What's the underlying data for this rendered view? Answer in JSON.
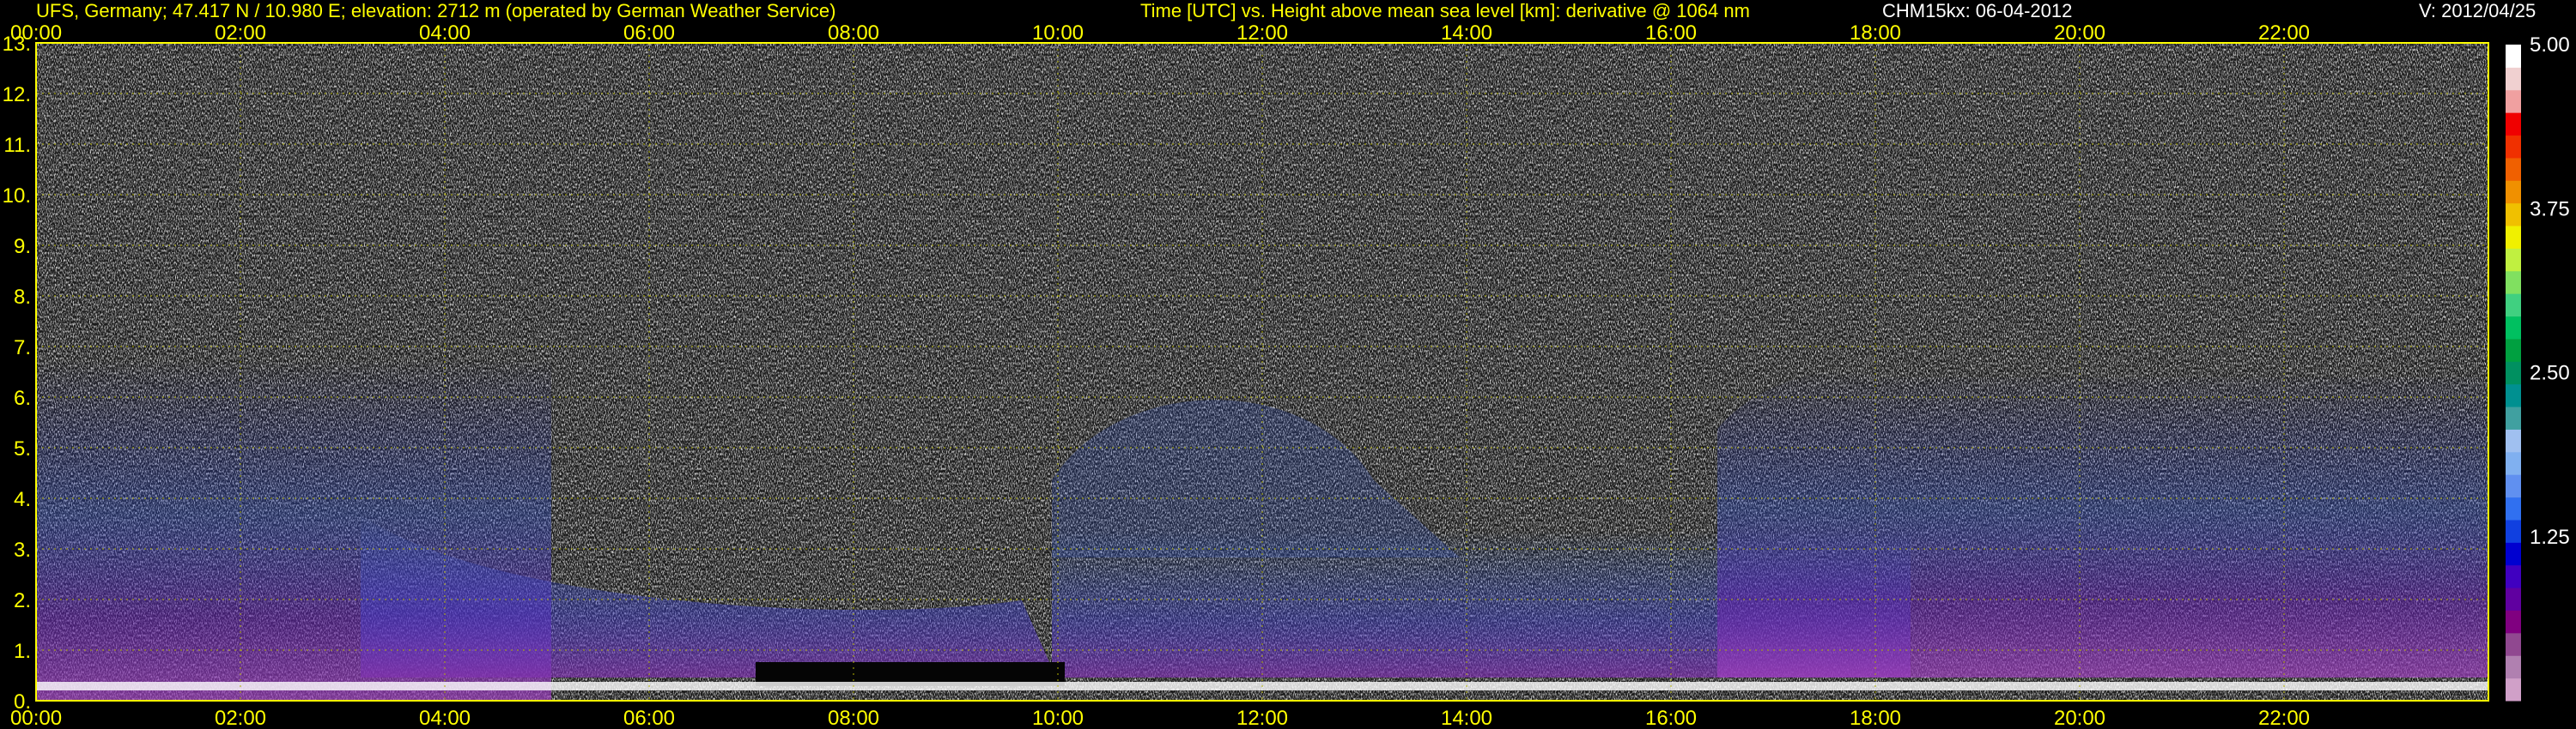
{
  "header": {
    "station": "UFS, Germany; 47.417 N / 10.980 E; elevation: 2712 m  (operated by German Weather Service)",
    "axes": "Time [UTC] vs. Height above mean sea level [km]: derivative @ 1064 nm",
    "instrument": "CHM15kx: 06-04-2012",
    "version": "V: 2012/04/25"
  },
  "colors": {
    "background": "#000000",
    "axis_text": "#ffff00",
    "grid": "#b4b400",
    "header_white": "#ffffff"
  },
  "chart_data": {
    "type": "heatmap",
    "title": "Time [UTC] vs. Height above mean sea level [km]: derivative @ 1064 nm",
    "xlabel": "Time [UTC]",
    "ylabel": "Height above mean sea level [km]",
    "x_ticks": [
      "00:00",
      "02:00",
      "04:00",
      "06:00",
      "08:00",
      "10:00",
      "12:00",
      "14:00",
      "16:00",
      "18:00",
      "20:00",
      "22:00"
    ],
    "x_tick_hours": [
      0,
      2,
      4,
      6,
      8,
      10,
      12,
      14,
      16,
      18,
      20,
      22
    ],
    "xlim_hours": [
      0,
      24
    ],
    "y_ticks": [
      "0.",
      "1.",
      "2.",
      "3.",
      "4.",
      "5.",
      "6.",
      "7.",
      "8.",
      "9.",
      "10.",
      "11.",
      "12.",
      "13."
    ],
    "y_tick_values": [
      0,
      1,
      2,
      3,
      4,
      5,
      6,
      7,
      8,
      9,
      10,
      11,
      12,
      13
    ],
    "ylim": [
      0,
      13
    ],
    "grid": true,
    "colorbar": {
      "range": [
        0,
        5.0
      ],
      "ticks": [
        "1.25",
        "2.50",
        "3.75",
        "5.00"
      ],
      "tick_values": [
        1.25,
        2.5,
        3.75,
        5.0
      ],
      "colors": [
        "#d0a0c8",
        "#b080b0",
        "#904890",
        "#800080",
        "#6000a0",
        "#4000c0",
        "#0000d0",
        "#1040e0",
        "#3070f0",
        "#6090f0",
        "#80b0f0",
        "#a0c0f0",
        "#40a0a0",
        "#009090",
        "#009060",
        "#00a040",
        "#00c060",
        "#40d080",
        "#80e060",
        "#c0f040",
        "#f0f000",
        "#f0c000",
        "#f09000",
        "#f06000",
        "#f03000",
        "#f00000",
        "#f0a0a0",
        "#f0d0d0",
        "#ffffff"
      ]
    }
  }
}
